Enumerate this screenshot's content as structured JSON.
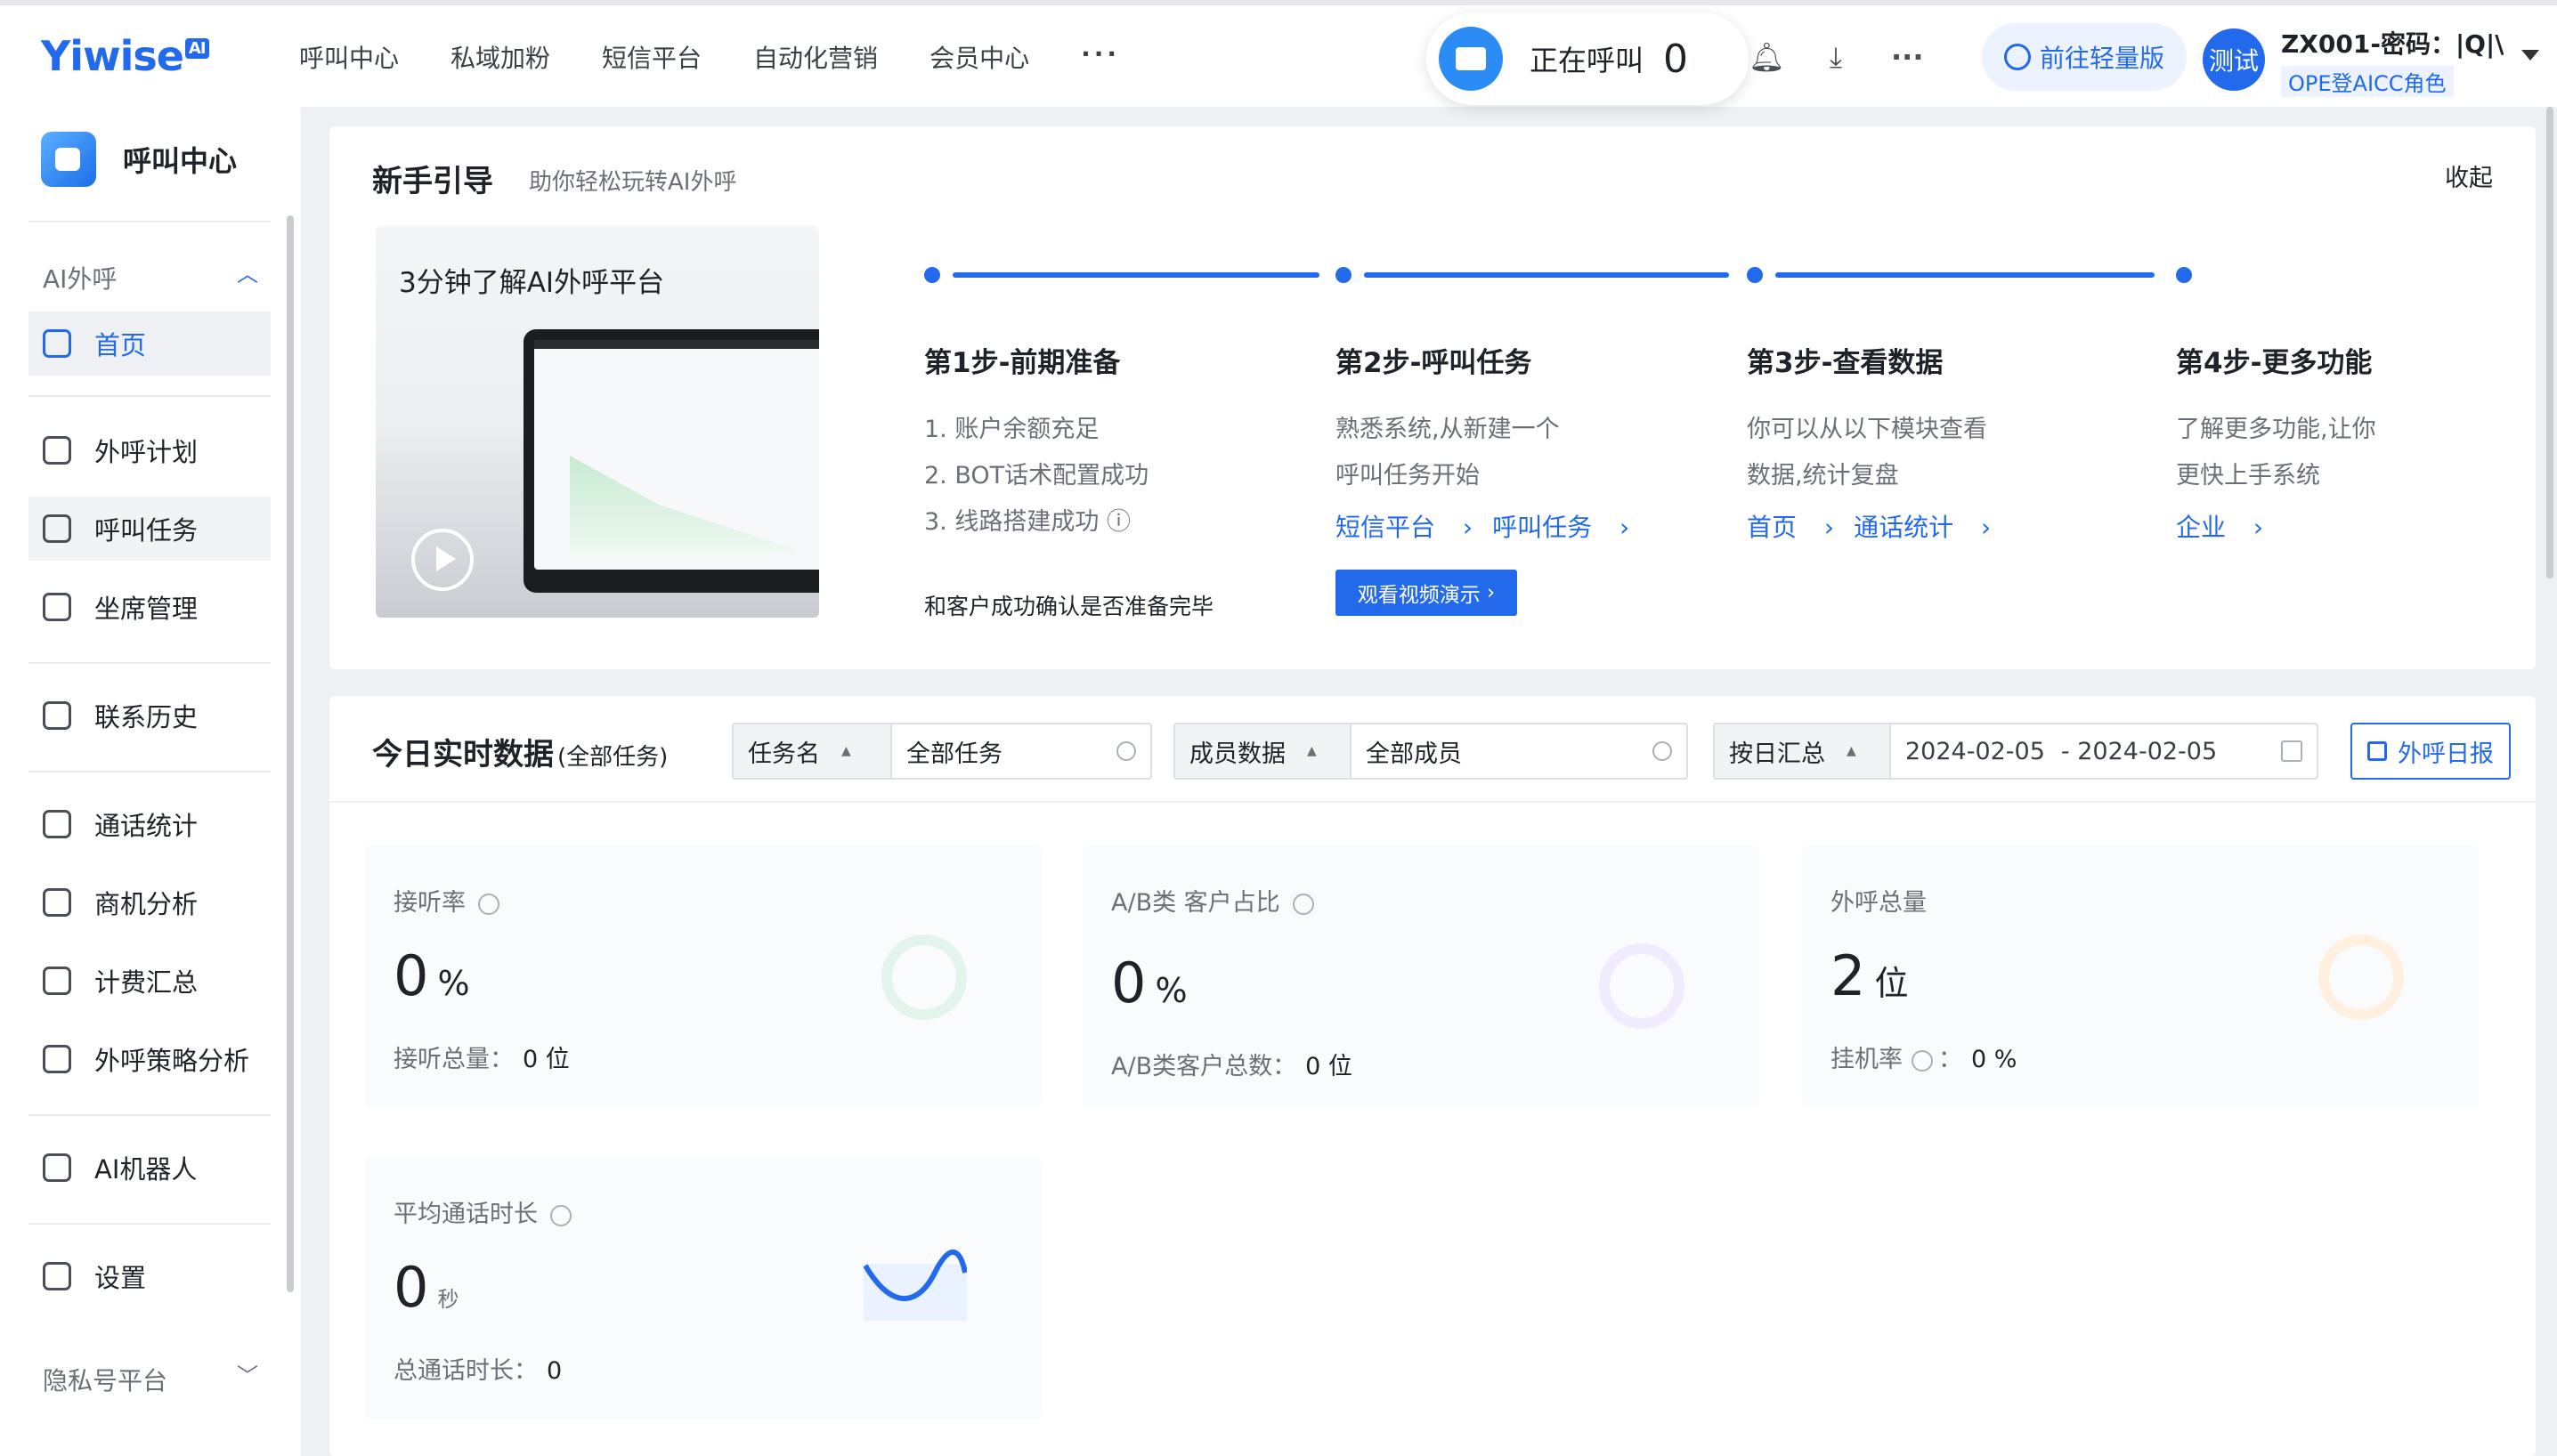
{
  "header": {
    "logo": "Yiwise",
    "logo_badge": "AI",
    "nav": [
      "呼叫中心",
      "私域加粉",
      "短信平台",
      "自动化营销",
      "会员中心"
    ],
    "nav_more": "···",
    "calling_label": "正在呼叫",
    "calling_count": "0",
    "lite_label": "前往轻量版",
    "avatar_text": "测试",
    "user_name": "ZX001-密码：|Q|\\...",
    "user_role": "OPE登AICC角色"
  },
  "sidebar": {
    "title": "呼叫中心",
    "group_ai": "AI外呼",
    "items": {
      "home": "首页",
      "plan": "外呼计划",
      "task": "呼叫任务",
      "agent": "坐席管理",
      "history": "联系历史",
      "stats": "通话统计",
      "biz": "商机分析",
      "billing": "计费汇总",
      "strategy": "外呼策略分析",
      "robot": "AI机器人",
      "settings": "设置"
    },
    "group_privacy": "隐私号平台"
  },
  "guide": {
    "title": "新手引导",
    "subtitle": "助你轻松玩转AI外呼",
    "collapse": "收起",
    "video_title": "3分钟了解AI外呼平台",
    "steps": [
      {
        "title": "第1步-前期准备",
        "lines": [
          "1. 账户余额充足",
          "2. BOT话术配置成功",
          "3. 线路搭建成功"
        ]
      },
      {
        "title": "第2步-呼叫任务",
        "lines": [
          "熟悉系统,从新建一个",
          "呼叫任务开始"
        ],
        "links": [
          "短信平台",
          "呼叫任务"
        ]
      },
      {
        "title": "第3步-查看数据",
        "lines": [
          "你可以从以下模块查看",
          "数据,统计复盘"
        ],
        "links": [
          "首页",
          "通话统计"
        ]
      },
      {
        "title": "第4步-更多功能",
        "lines": [
          "了解更多功能,让你",
          "更快上手系统"
        ],
        "links": [
          "企业"
        ]
      }
    ],
    "confirm_note": "和客户成功确认是否准备完毕",
    "video_button": "观看视频演示"
  },
  "realtime": {
    "title": "今日实时数据",
    "scope": "(全部任务)",
    "filter_task_label": "任务名",
    "filter_task_value": "全部任务",
    "filter_member_label": "成员数据",
    "filter_member_value": "全部成员",
    "filter_date_label": "按日汇总",
    "date_start": "2024-02-05",
    "date_end": "- 2024-02-05",
    "daily_report": "外呼日报",
    "metrics": {
      "answer_rate": {
        "label": "接听率",
        "value": "0",
        "unit": "%",
        "sub_label": "接听总量：",
        "sub_value": "0 位"
      },
      "ab_ratio": {
        "label": "A/B类 客户占比",
        "value": "0",
        "unit": "%",
        "sub_label": "A/B类客户总数：",
        "sub_value": "0 位"
      },
      "total_calls": {
        "label": "外呼总量",
        "value": "2",
        "unit": "位",
        "sub_label": "挂机率",
        "sub_value": "0 %"
      },
      "avg_duration": {
        "label": "平均通话时长",
        "value": "0",
        "unit": "秒",
        "sub_label": "总通话时长：",
        "sub_value": "0"
      }
    }
  },
  "colors": {
    "accent": "#2269ec",
    "ring_green": "#e3f5ea",
    "ring_purple": "#f0ebff",
    "ring_orange": "#fff0e0"
  }
}
